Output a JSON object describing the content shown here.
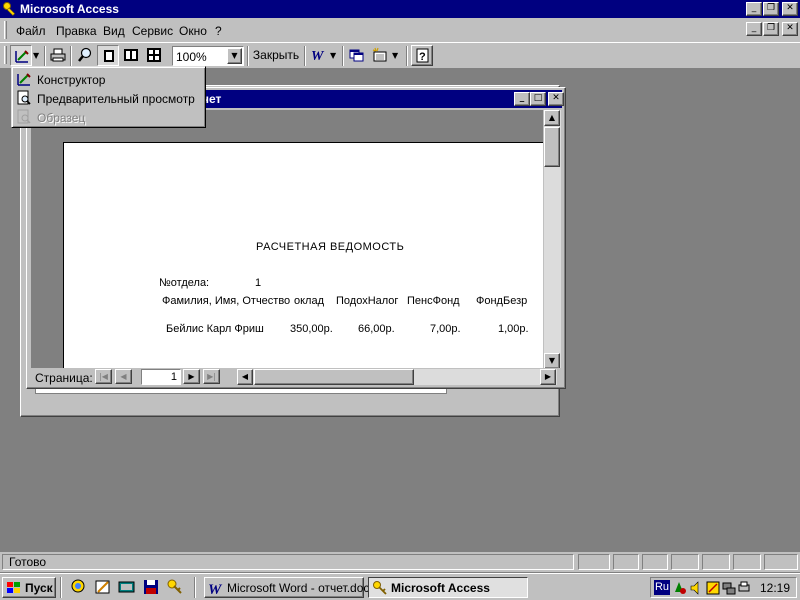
{
  "app": {
    "title": "Microsoft Access"
  },
  "menu": {
    "items": [
      "Файл",
      "Правка",
      "Вид",
      "Сервис",
      "Окно",
      "?"
    ]
  },
  "toolbar": {
    "zoom": "100%",
    "close_label": "Закрыть"
  },
  "view_menu": {
    "items": [
      {
        "label": "Конструктор",
        "icon": "design-view-icon",
        "enabled": true
      },
      {
        "label": "Предварительный просмотр",
        "icon": "print-preview-icon",
        "enabled": true
      },
      {
        "label": "Образец",
        "icon": "layout-preview-icon",
        "enabled": false
      }
    ]
  },
  "report_window": {
    "title_visible": "чет",
    "report": {
      "title": "РАСЧЕТНАЯ  ВЕДОМОСТЬ",
      "dept_label": "№отдела:",
      "dept_value": "1",
      "headers": [
        "Фамилия, Имя, Отчество",
        "оклад",
        "ПодохНалог",
        "ПенсФонд",
        "ФондБезр"
      ],
      "rows": [
        [
          "Бейлис Карл Фриш",
          "350,00р.",
          "66,00р.",
          "7,00р.",
          "1,00р."
        ]
      ]
    },
    "nav": {
      "page_label": "Страница:",
      "page_number": "1"
    }
  },
  "status": {
    "text": "Готово"
  },
  "taskbar": {
    "start_label": "Пуск",
    "tasks": [
      {
        "label": "Microsoft Word - отчет.doc",
        "active": false
      },
      {
        "label": "Microsoft Access",
        "active": true
      }
    ],
    "tray": {
      "lang": "Ru",
      "time": "12:19"
    }
  }
}
